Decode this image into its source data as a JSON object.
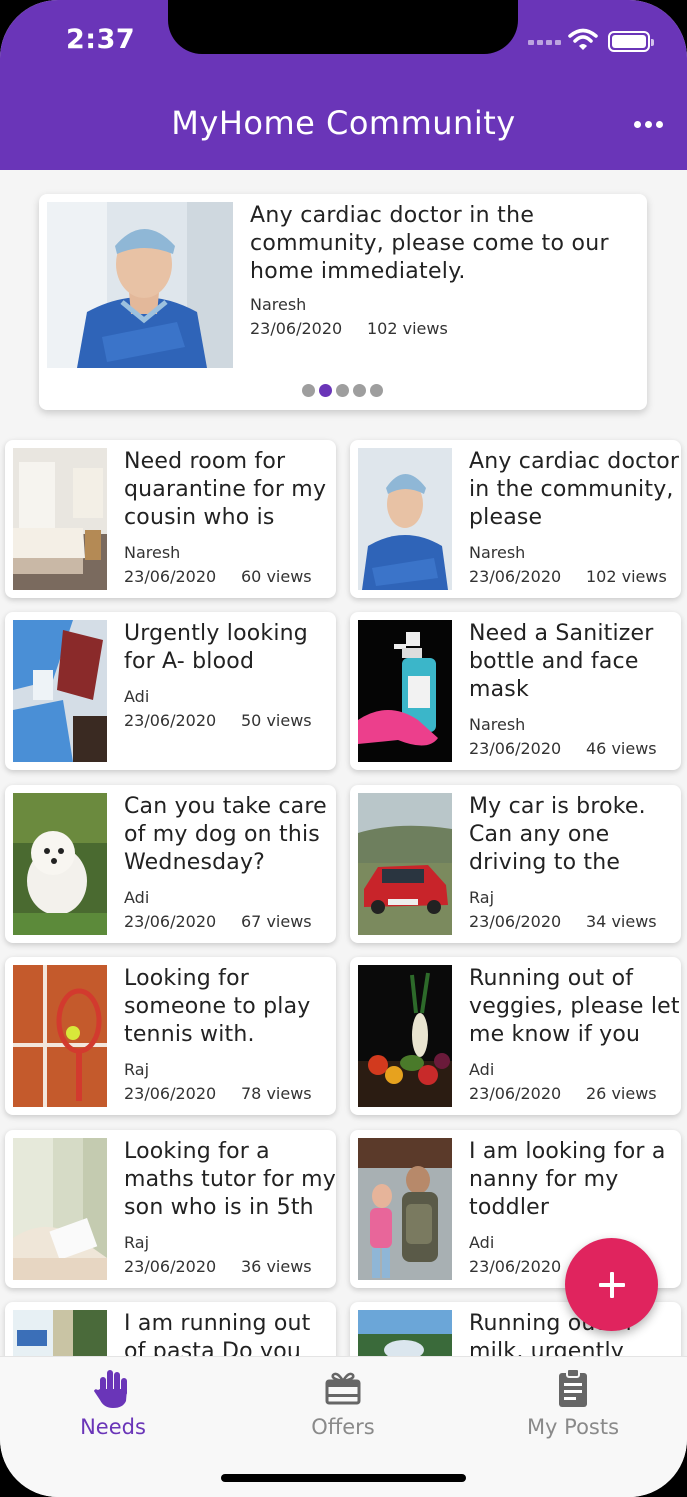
{
  "status_bar": {
    "time": "2:37"
  },
  "header": {
    "title": "MyHome Community"
  },
  "featured": {
    "title": "Any cardiac doctor in the community, please come to our home immediately.",
    "author": "Naresh",
    "date": "23/06/2020",
    "views": "102 views",
    "image": "doctor-photo",
    "carousel_pages": 5,
    "carousel_active": 2
  },
  "posts": [
    {
      "title": "Need room for quarantine for my cousin who is",
      "author": "Naresh",
      "date": "23/06/2020",
      "views": "60 views",
      "image": "bedroom-photo"
    },
    {
      "title": "Any cardiac doctor in the community, please",
      "author": "Naresh",
      "date": "23/06/2020",
      "views": "102 views",
      "image": "doctor-photo"
    },
    {
      "title": "Urgently looking for A- blood",
      "author": "Adi",
      "date": "23/06/2020",
      "views": "50 views",
      "image": "blood-bag-photo"
    },
    {
      "title": "Need a Sanitizer bottle and face mask",
      "author": "Naresh",
      "date": "23/06/2020",
      "views": "46 views",
      "image": "sanitizer-photo"
    },
    {
      "title": "Can you take care of my dog on this Wednesday?",
      "author": "Adi",
      "date": "23/06/2020",
      "views": "67 views",
      "image": "dog-photo"
    },
    {
      "title": "My car is broke. Can any one driving to the",
      "author": "Raj",
      "date": "23/06/2020",
      "views": "34 views",
      "image": "red-car-photo"
    },
    {
      "title": "Looking for someone to play tennis with.",
      "author": "Raj",
      "date": "23/06/2020",
      "views": "78 views",
      "image": "tennis-racket-photo"
    },
    {
      "title": "Running out of veggies, please let me know if you",
      "author": "Adi",
      "date": "23/06/2020",
      "views": "26 views",
      "image": "vegetables-photo"
    },
    {
      "title": "Looking for a maths tutor for my son who is in 5th",
      "author": "Raj",
      "date": "23/06/2020",
      "views": "36 views",
      "image": "tutor-photo"
    },
    {
      "title": "I am looking for a nanny for my toddler",
      "author": "Adi",
      "date": "23/06/2020",
      "views": "",
      "image": "nanny-photo"
    },
    {
      "title": "I am running out of pasta Do you",
      "author": "",
      "date": "",
      "views": "",
      "image": "pasta-photo"
    },
    {
      "title": "Running out of milk, urgently",
      "author": "",
      "date": "",
      "views": "",
      "image": "milk-photo"
    }
  ],
  "fab": {
    "icon": "plus-icon"
  },
  "tabs": [
    {
      "label": "Needs",
      "icon": "hand-icon",
      "active": true
    },
    {
      "label": "Offers",
      "icon": "gift-icon",
      "active": false
    },
    {
      "label": "My Posts",
      "icon": "clipboard-icon",
      "active": false
    }
  ],
  "colors": {
    "primary": "#6a35b8",
    "fab": "#e0245e",
    "tab_inactive": "#8a8a8a"
  }
}
